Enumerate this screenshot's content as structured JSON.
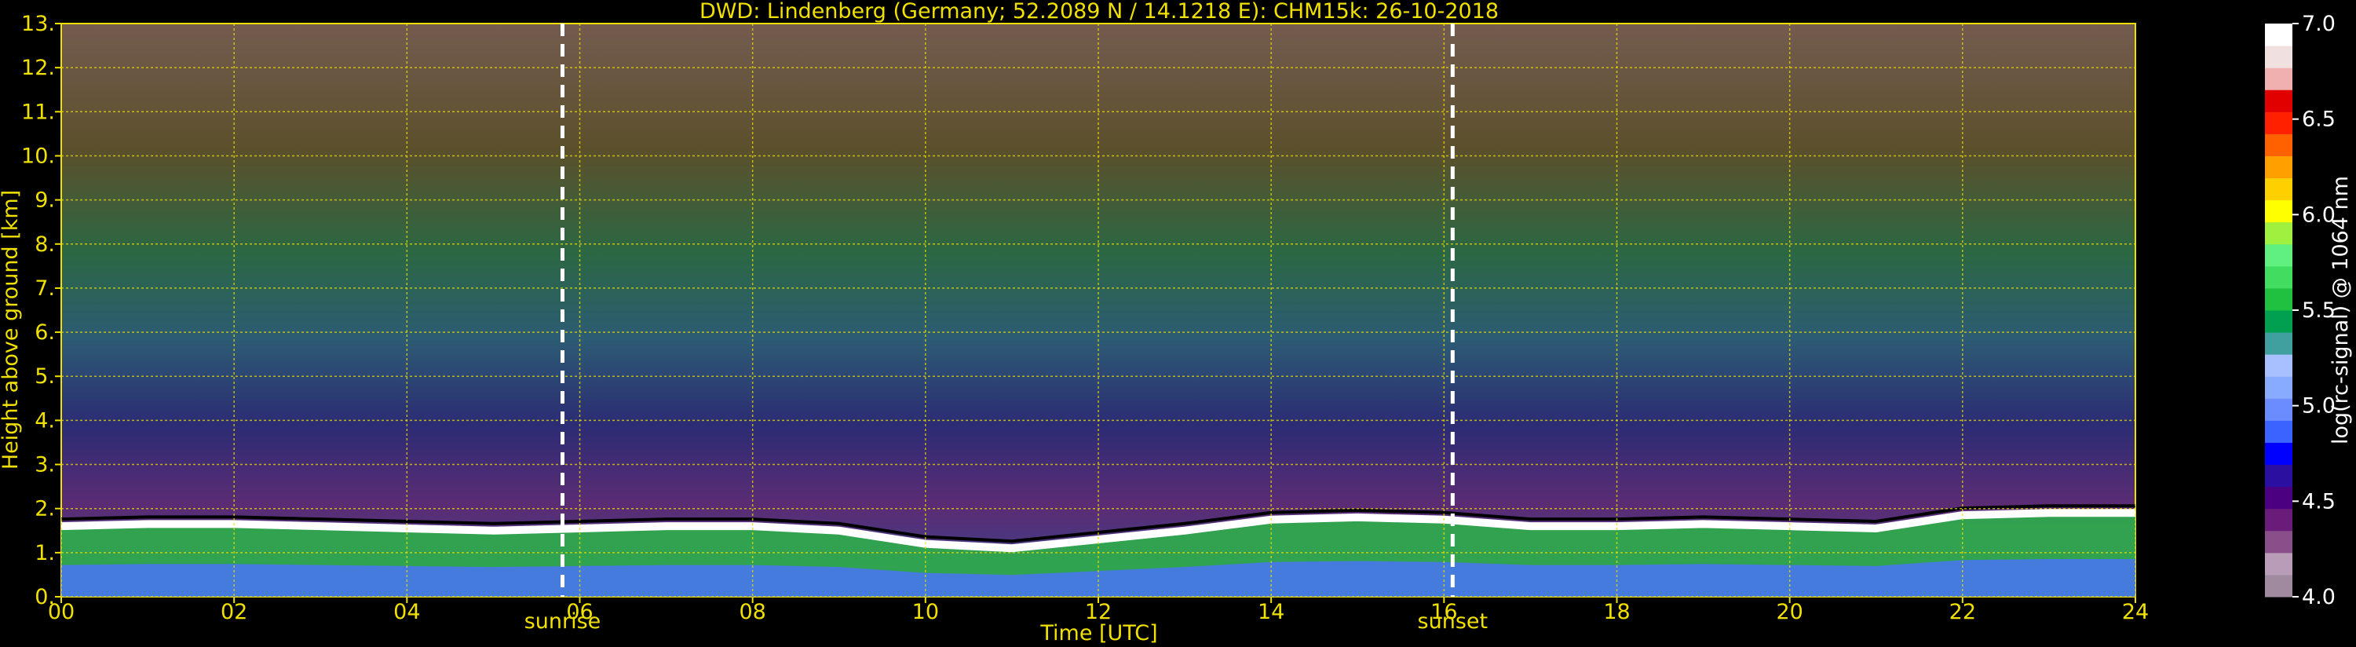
{
  "chart_data": {
    "type": "heatmap",
    "title": "DWD: Lindenberg (Germany; 52.2089 N / 14.1218 E):    CHM15k: 26-10-2018",
    "xlabel": "Time [UTC]",
    "ylabel": "Height above ground [km]",
    "xlim": [
      0,
      24
    ],
    "ylim": [
      0,
      13
    ],
    "x_ticks": [
      "00",
      "02",
      "04",
      "06",
      "08",
      "10",
      "12",
      "14",
      "16",
      "18",
      "20",
      "22",
      "24"
    ],
    "y_ticks": [
      "0.",
      "1.",
      "2.",
      "3.",
      "4.",
      "5.",
      "6.",
      "7.",
      "8.",
      "9.",
      "10.",
      "11.",
      "12.",
      "13."
    ],
    "grid": true,
    "annotations": [
      {
        "label": "sunrise",
        "x": 5.8
      },
      {
        "label": "sunset",
        "x": 16.1
      }
    ],
    "colorbar": {
      "label": "log(rc-signal) @ 1064 nm",
      "range": [
        4.0,
        7.0
      ],
      "ticks": [
        "4.0",
        "4.5",
        "5.0",
        "5.5",
        "6.0",
        "6.5",
        "7.0"
      ],
      "colors": [
        "#a08aa0",
        "#b89cb8",
        "#8a4f8a",
        "#6a1c7a",
        "#4b0082",
        "#2a0fa0",
        "#0000ff",
        "#3a63ff",
        "#6b8cff",
        "#88aaff",
        "#a8c0ff",
        "#40a0a0",
        "#00a050",
        "#20c040",
        "#40dd60",
        "#60f080",
        "#a0f040",
        "#ffff00",
        "#ffd000",
        "#ffa000",
        "#ff6000",
        "#ff2000",
        "#e00000",
        "#f0b0b0",
        "#f0e0e0",
        "#ffffff"
      ]
    },
    "boundary_layer_top_km": [
      [
        0,
        1.6
      ],
      [
        1,
        1.65
      ],
      [
        2,
        1.65
      ],
      [
        3,
        1.6
      ],
      [
        4,
        1.55
      ],
      [
        5,
        1.5
      ],
      [
        6,
        1.55
      ],
      [
        7,
        1.6
      ],
      [
        8,
        1.6
      ],
      [
        9,
        1.5
      ],
      [
        10,
        1.2
      ],
      [
        11,
        1.1
      ],
      [
        12,
        1.3
      ],
      [
        13,
        1.5
      ],
      [
        14,
        1.75
      ],
      [
        15,
        1.8
      ],
      [
        16,
        1.75
      ],
      [
        17,
        1.6
      ],
      [
        18,
        1.6
      ],
      [
        19,
        1.65
      ],
      [
        20,
        1.6
      ],
      [
        21,
        1.55
      ],
      [
        22,
        1.85
      ],
      [
        23,
        1.9
      ],
      [
        24,
        1.9
      ]
    ]
  }
}
